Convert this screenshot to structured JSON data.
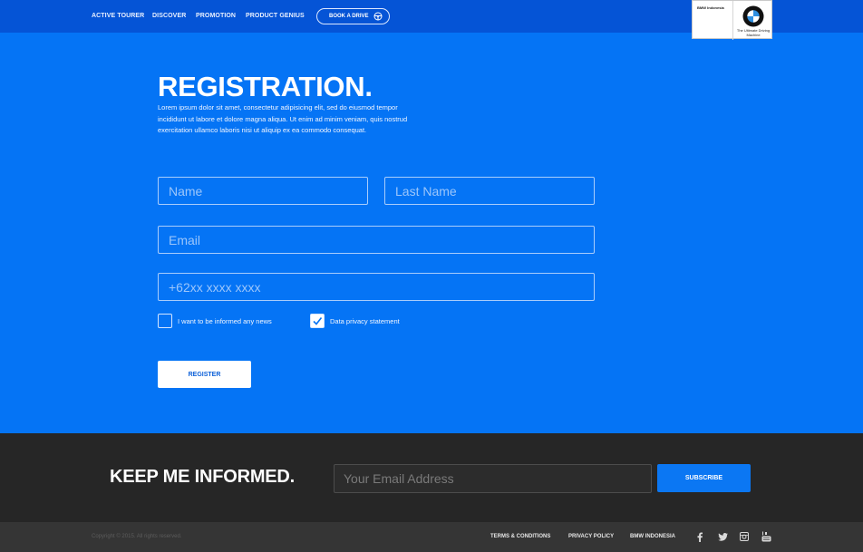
{
  "nav": {
    "items": [
      "ACTIVE TOURER",
      "DISCOVER",
      "PROMOTION",
      "PRODUCT GENIUS"
    ],
    "book_label": "BOOK A DRIVE"
  },
  "brand": {
    "name": "BMW Indonesia",
    "tagline": "The Ultimate Driving Machine"
  },
  "registration": {
    "title": "REGISTRATION.",
    "intro": "Lorem ipsum dolor sit amet, consectetur adipisicing elit, sed do eiusmod tempor incididunt ut labore et dolore magna aliqua. Ut enim ad minim veniam, quis nostrud exercitation ullamco laboris nisi ut aliquip ex ea commodo consequat.",
    "first_name_placeholder": "Name",
    "last_name_placeholder": "Last Name",
    "email_placeholder": "Email",
    "phone_placeholder": "+62xx xxxx xxxx",
    "news_checkbox": {
      "label": "I want to be informed any news",
      "checked": false
    },
    "privacy_checkbox": {
      "label": "Data privacy statement",
      "checked": true
    },
    "register_label": "REGISTER"
  },
  "newsletter": {
    "title": "KEEP ME INFORMED.",
    "email_placeholder": "Your Email Address",
    "subscribe_label": "SUBSCRIBE"
  },
  "footer": {
    "copyright": "Copyright © 2015. All rights reserved.",
    "links": [
      "TERMS & CONDITIONS",
      "PRIVACY POLICY",
      "BMW INDONESIA"
    ],
    "social_icons": [
      "facebook-icon",
      "twitter-icon",
      "instagram-icon",
      "youtube-icon"
    ]
  },
  "colors": {
    "primary_blue": "#0574f5",
    "nav_blue": "#0554d6",
    "newsletter_bg": "#262626",
    "footer_bg": "#353535"
  }
}
